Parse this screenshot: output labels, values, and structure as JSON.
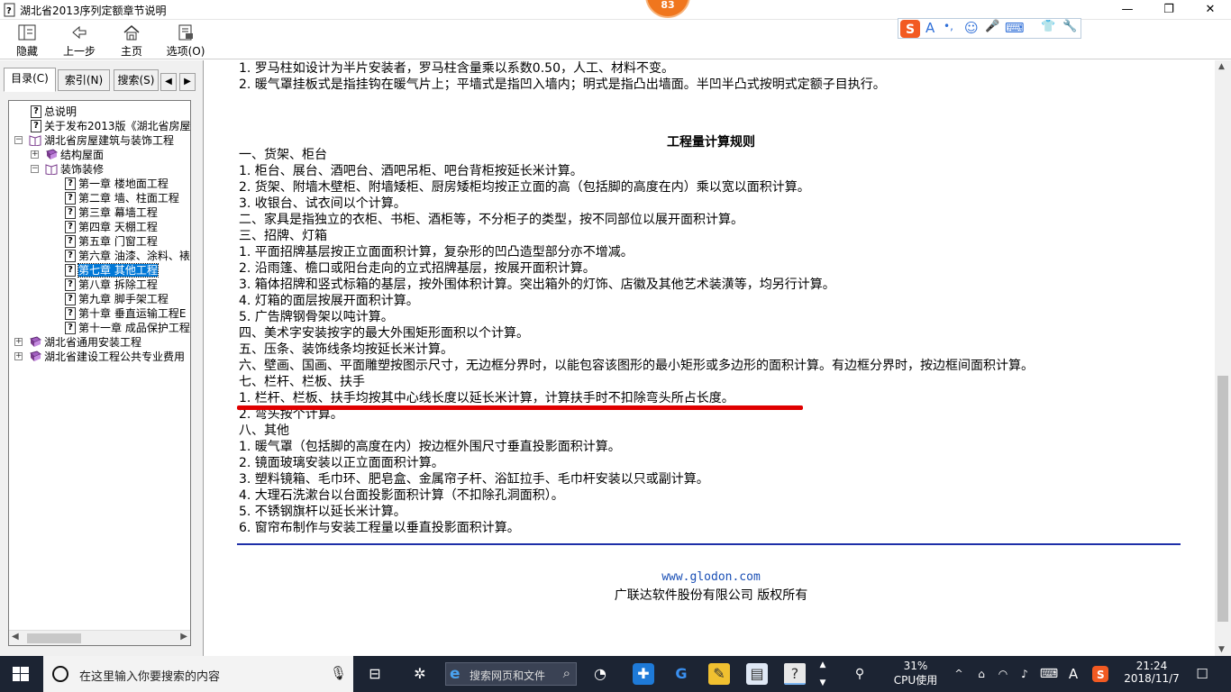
{
  "window": {
    "title": "湖北省2013序列定额章节说明",
    "badge": "83",
    "minimize": "—",
    "maximize": "❐",
    "close": "✕"
  },
  "toolbar": {
    "hide_label": "隐藏",
    "back_label": "上一步",
    "home_label": "主页",
    "options_label": "选项(O)"
  },
  "ime": [
    "A",
    "•,",
    "☺",
    "🎤",
    "⌨",
    "👕",
    "🔧"
  ],
  "left_tabs": {
    "contents": "目录(C)",
    "index": "索引(N)",
    "search": "搜索(S)"
  },
  "tree": [
    {
      "label": "总说明",
      "icon": "page"
    },
    {
      "label": "关于发布2013版《湖北省房屋",
      "icon": "page"
    },
    {
      "label": "湖北省房屋建筑与装饰工程",
      "icon": "book-open",
      "expander": "⊟"
    },
    {
      "label": "结构屋面",
      "icon": "book",
      "expander": "⊞"
    },
    {
      "label": "装饰装修",
      "icon": "book-open",
      "expander": "⊟"
    },
    {
      "label": "第一章  楼地面工程",
      "icon": "page"
    },
    {
      "label": "第二章  墙、柱面工程",
      "icon": "page"
    },
    {
      "label": "第三章  幕墙工程",
      "icon": "page"
    },
    {
      "label": "第四章  天棚工程",
      "icon": "page"
    },
    {
      "label": "第五章  门窗工程",
      "icon": "page"
    },
    {
      "label": "第六章  油漆、涂料、裱",
      "icon": "page"
    },
    {
      "label": "第七章  其他工程",
      "icon": "page",
      "selected": true
    },
    {
      "label": "第八章  拆除工程",
      "icon": "page"
    },
    {
      "label": "第九章  脚手架工程",
      "icon": "page"
    },
    {
      "label": "第十章  垂直运输工程E",
      "icon": "page"
    },
    {
      "label": "第十一章  成品保护工程",
      "icon": "page"
    },
    {
      "label": "湖北省通用安装工程",
      "icon": "book",
      "expander": "⊞"
    },
    {
      "label": "湖北省建设工程公共专业费用",
      "icon": "book",
      "expander": "⊞"
    }
  ],
  "content": {
    "top_lines": [
      "1. 罗马柱如设计为半片安装者，罗马柱含量乘以系数0.50，人工、材料不变。",
      "2. 暖气罩挂板式是指挂钩在暖气片上；平墙式是指凹入墙内；明式是指凸出墙面。半凹半凸式按明式定额子目执行。"
    ],
    "heading": "工程量计算规则",
    "lines": [
      "一、货架、柜台",
      "1. 柜台、展台、酒吧台、酒吧吊柜、吧台背柜按延长米计算。",
      "2. 货架、附墙木壁柜、附墙矮柜、厨房矮柜均按正立面的高（包括脚的高度在内）乘以宽以面积计算。",
      "3. 收银台、试衣间以个计算。",
      "二、家具是指独立的衣柜、书柜、酒柜等，不分柜子的类型，按不同部位以展开面积计算。",
      "三、招牌、灯箱",
      "1. 平面招牌基层按正立面面积计算，复杂形的凹凸造型部分亦不增减。",
      "2. 沿雨篷、檐口或阳台走向的立式招牌基层，按展开面积计算。",
      "3. 箱体招牌和竖式标箱的基层，按外围体积计算。突出箱外的灯饰、店徽及其他艺术装潢等，均另行计算。",
      "4. 灯箱的面层按展开面积计算。",
      "5. 广告牌钢骨架以吨计算。",
      "四、美术字安装按字的最大外围矩形面积以个计算。",
      "五、压条、装饰线条均按延长米计算。",
      "六、壁画、国画、平面雕塑按图示尺寸，无边框分界时，以能包容该图形的最小矩形或多边形的面积计算。有边框分界时，按边框间面积计算。",
      "七、栏杆、栏板、扶手",
      "1. 栏杆、栏板、扶手均按其中心线长度以延长米计算，计算扶手时不扣除弯头所占长度。",
      "2. 弯头按个计算。",
      "八、其他",
      "1. 暖气罩（包括脚的高度在内）按边框外围尺寸垂直投影面积计算。",
      "2. 镜面玻璃安装以正立面面积计算。",
      "3. 塑料镜箱、毛巾环、肥皂盒、金属帘子杆、浴缸拉手、毛巾杆安装以只或副计算。",
      "4. 大理石洗漱台以台面投影面积计算（不扣除孔洞面积）。",
      "5. 不锈钢旗杆以延长米计算。",
      "6. 窗帘布制作与安装工程量以垂直投影面积计算。"
    ],
    "website": "www.glodon.com",
    "copyright": "广联达软件股份有限公司 版权所有"
  },
  "taskbar": {
    "search_placeholder": "在这里输入你要搜索的内容",
    "web_search": "搜索网页和文件",
    "cpu_percent": "31%",
    "cpu_label": "CPU使用",
    "time": "21:24",
    "date": "2018/11/7",
    "ime_indicator": "A"
  }
}
